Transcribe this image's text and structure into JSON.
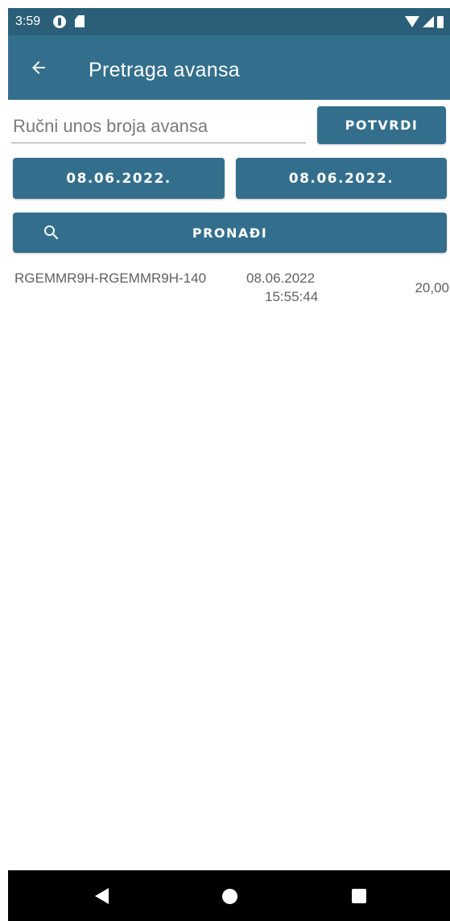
{
  "status_bar": {
    "time": "3:59",
    "icons": [
      "data-saver-icon",
      "sd-card-icon",
      "wifi-icon",
      "signal-icon",
      "battery-icon"
    ]
  },
  "app_bar": {
    "title": "Pretraga avansa",
    "back_icon": "arrow-back-icon"
  },
  "search": {
    "manual_input_placeholder": "Ručni unos broja avansa",
    "manual_input_value": "",
    "confirm_label": "POTVRDI",
    "date_from": "08.06.2022.",
    "date_to": "08.06.2022.",
    "find_label": "PRONAĐI",
    "find_icon": "search-icon"
  },
  "results": [
    {
      "number": "RGEMMR9H-RGEMMR9H-140",
      "date": "08.06.2022",
      "time": "15:55:44",
      "amount": "20,00"
    }
  ],
  "nav_bar": {
    "icons": [
      "nav-back-icon",
      "nav-home-icon",
      "nav-recents-icon"
    ]
  },
  "colors": {
    "primary": "#336f8d",
    "status_bar": "#2b5e78",
    "text_secondary": "#606060"
  }
}
